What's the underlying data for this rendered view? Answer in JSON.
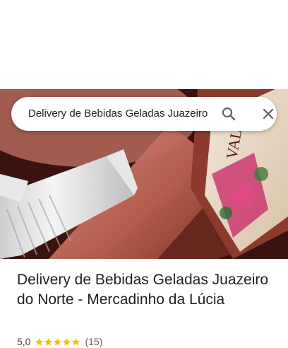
{
  "search": {
    "query": "Delivery de Bebidas Geladas Juazeiro"
  },
  "place": {
    "title": "Delivery de Bebidas Geladas Juazeiro do Norte - Mercadinho da Lúcia",
    "rating": "5,0",
    "stars": 5,
    "review_count": "(15)"
  },
  "colors": {
    "star": "#fbbc04",
    "accent_text": "#202124",
    "secondary_text": "#5f6368"
  }
}
